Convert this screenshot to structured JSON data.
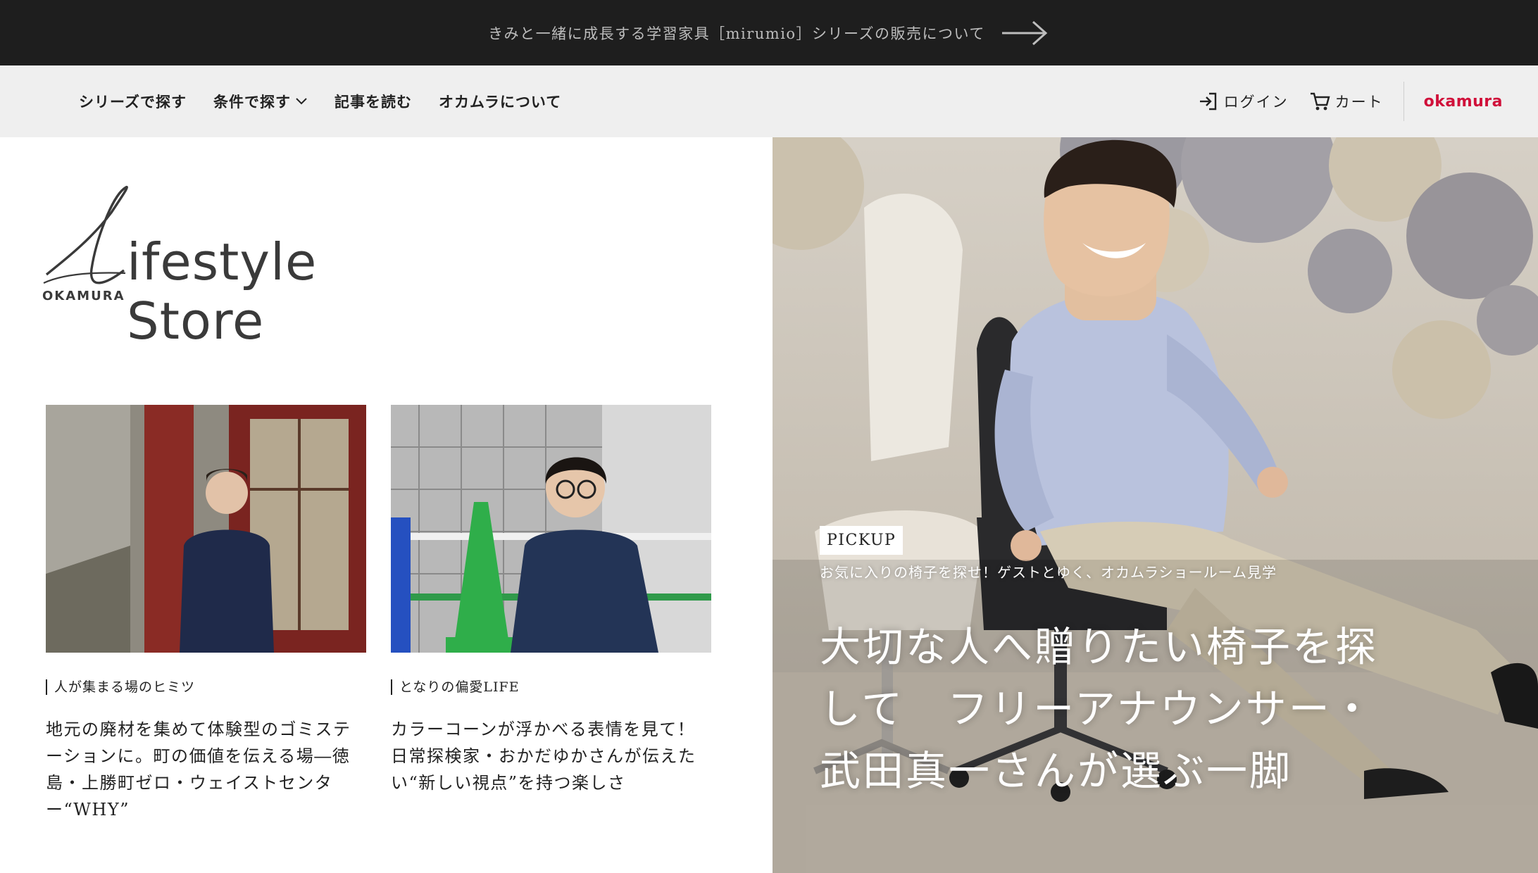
{
  "announcement": {
    "text": "きみと一緒に成長する学習家具［mirumio］シリーズの販売について"
  },
  "nav": {
    "items": [
      {
        "label": "シリーズで探す"
      },
      {
        "label": "条件で探す"
      },
      {
        "label": "記事を読む"
      },
      {
        "label": "オカムラについて"
      }
    ],
    "login_label": "ログイン",
    "cart_label": "カート",
    "brand": "okamura",
    "brand_color": "#d0103a"
  },
  "site_logo": {
    "text": "ifestyle Store",
    "sub": "OKAMURA"
  },
  "cards": [
    {
      "category": "人が集まる場のヒミツ",
      "title": "地元の廃材を集めて体験型のゴミステーションに。町の価値を伝える場―徳島・上勝町ゼロ・ウェイストセンター“WHY”"
    },
    {
      "category": "となりの偏愛LIFE",
      "title": "カラーコーンが浮かべる表情を見て！日常探検家・おかだゆかさんが伝えたい“新しい視点”を持つ楽しさ"
    }
  ],
  "hero": {
    "badge": "PICKUP",
    "subtitle": "お気に入りの椅子を探せ！ゲストとゆく、オカムラショールーム見学",
    "title": "大切な人へ贈りたい椅子を探して　フリーアナウンサー・武田真一さんが選ぶ一脚"
  }
}
